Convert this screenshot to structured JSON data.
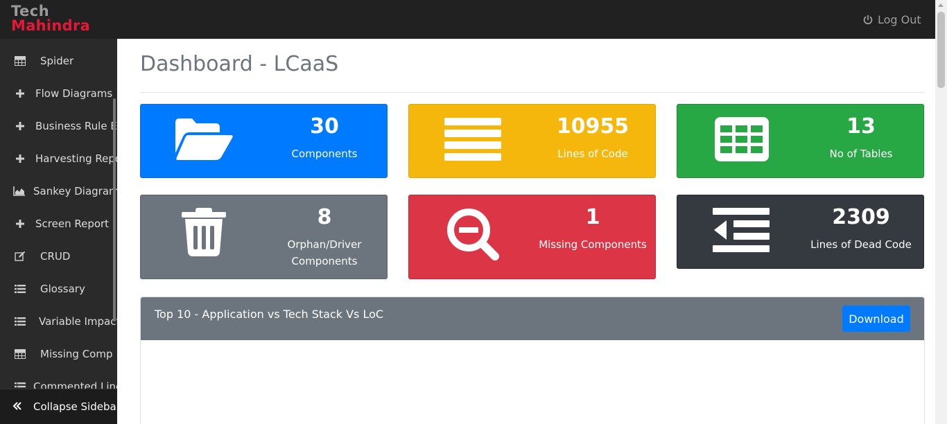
{
  "brand": {
    "line1": "Tech",
    "line2": "Mahindra"
  },
  "header": {
    "logout_label": "Log Out",
    "logout_icon": "power-icon"
  },
  "sidebar": {
    "items": [
      {
        "label": "Spider",
        "icon": "table-icon"
      },
      {
        "label": "Flow Diagrams",
        "icon": "plus-icon"
      },
      {
        "label": "Business Rule Ex",
        "icon": "plus-icon"
      },
      {
        "label": "Harvesting Repo",
        "icon": "plus-icon"
      },
      {
        "label": "Sankey Diagram",
        "icon": "area-chart-icon"
      },
      {
        "label": "Screen Report",
        "icon": "plus-icon"
      },
      {
        "label": "CRUD",
        "icon": "edit-icon"
      },
      {
        "label": "Glossary",
        "icon": "list-icon"
      },
      {
        "label": "Variable Impact",
        "icon": "list-icon"
      },
      {
        "label": "Missing Comp",
        "icon": "table-icon"
      },
      {
        "label": "Commented Line",
        "icon": "list-icon"
      }
    ],
    "collapse_label": "Collapse Sidebar",
    "collapse_icon": "double-chevron-left-icon"
  },
  "main": {
    "title": "Dashboard - LCaaS",
    "cards": [
      {
        "value": "30",
        "label": "Components",
        "icon": "folder-open-icon",
        "color": "#007bff"
      },
      {
        "value": "10955",
        "label": "Lines of Code",
        "icon": "bars-icon",
        "color": "#f5b70b"
      },
      {
        "value": "13",
        "label": "No of Tables",
        "icon": "table-icon",
        "color": "#28a745"
      },
      {
        "value": "8",
        "label": "Orphan/Driver Components",
        "icon": "trash-icon",
        "color": "#6c757d"
      },
      {
        "value": "1",
        "label": "Missing Components",
        "icon": "search-minus-icon",
        "color": "#dc3545"
      },
      {
        "value": "2309",
        "label": "Lines of Dead Code",
        "icon": "outdent-icon",
        "color": "#343a40"
      }
    ],
    "panel": {
      "title": "Top 10 - Application vs Tech Stack Vs LoC",
      "download_label": "Download"
    }
  }
}
